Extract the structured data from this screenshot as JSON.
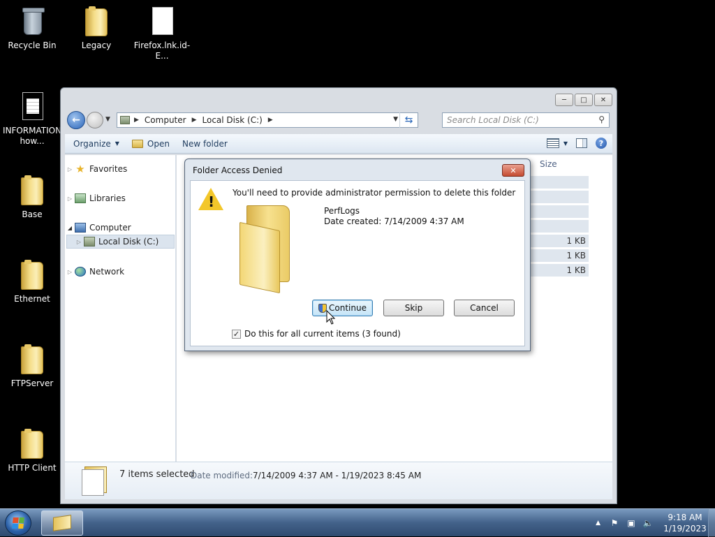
{
  "desktop": {
    "icons": [
      {
        "label": "Recycle Bin",
        "icon": "recycle-bin-icon"
      },
      {
        "label": "Legacy",
        "icon": "folder-icon"
      },
      {
        "label": "Firefox.lnk.id-E...",
        "icon": "file-icon"
      },
      {
        "label": "INFORMATION how...",
        "icon": "text-document-icon"
      },
      {
        "label": "Base",
        "icon": "folder-icon"
      },
      {
        "label": "Ethernet",
        "icon": "folder-icon"
      },
      {
        "label": "FTPServer",
        "icon": "folder-icon"
      },
      {
        "label": "HTTP Client",
        "icon": "folder-icon"
      }
    ]
  },
  "explorer": {
    "address": {
      "computer": "Computer",
      "drive": "Local Disk (C:)"
    },
    "search_placeholder": "Search Local Disk (C:)",
    "toolbar": {
      "organize": "Organize",
      "open": "Open",
      "new_folder": "New folder"
    },
    "nav": {
      "favorites": "Favorites",
      "libraries": "Libraries",
      "computer": "Computer",
      "local_disk": "Local Disk (C:)",
      "network": "Network"
    },
    "columns": {
      "size": "Size"
    },
    "sizes": [
      "",
      "",
      "",
      "",
      "1 KB",
      "1 KB",
      "1 KB"
    ],
    "details": {
      "count": "7 items selected",
      "date_modified_label": "Date modified:",
      "date_modified_value": "7/14/2009 4:37 AM - 1/19/2023 8:45 AM"
    }
  },
  "dialog": {
    "title": "Folder Access Denied",
    "message": "You'll need to provide administrator permission to delete this folder",
    "folder_name": "PerfLogs",
    "date_created": "Date created: 7/14/2009 4:37 AM",
    "buttons": {
      "continue": "Continue",
      "skip": "Skip",
      "cancel": "Cancel"
    },
    "checkbox_label": "Do this for all current items (3 found)",
    "checkbox_checked": true
  },
  "taskbar": {
    "time": "9:18 AM",
    "date": "1/19/2023"
  },
  "colors": {
    "desktop_bg": "#000000",
    "taskbar": "#43628a",
    "accent": "#2a65b9"
  }
}
